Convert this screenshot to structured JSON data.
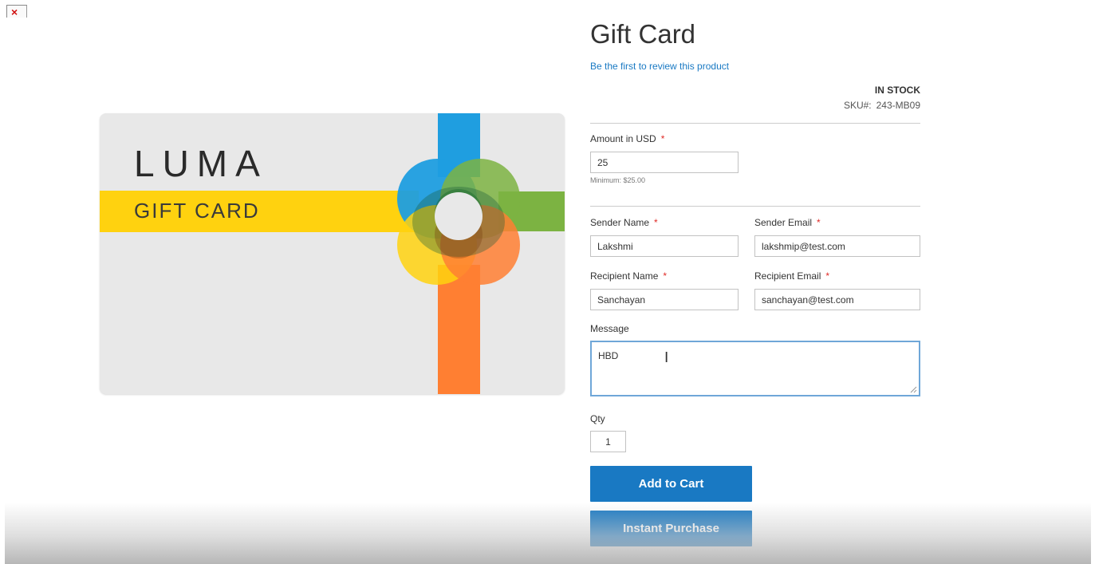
{
  "product": {
    "title": "Gift Card",
    "review_link": "Be the first to review this product",
    "stock": "IN STOCK",
    "sku_label": "SKU#:",
    "sku_value": "243-MB09"
  },
  "card_image": {
    "brand": "LUMA",
    "subtitle": "GIFT CARD",
    "colors": {
      "background": "#e8e8e8",
      "yellow": "#ffd20f",
      "blue": "#1f9ee0",
      "green": "#7cb342",
      "orange": "#ff7f32"
    }
  },
  "form": {
    "amount": {
      "label": "Amount in USD",
      "required": "*",
      "value": "25",
      "hint": "Minimum: $25.00"
    },
    "sender_name": {
      "label": "Sender Name",
      "required": "*",
      "value": "Lakshmi"
    },
    "sender_email": {
      "label": "Sender Email",
      "required": "*",
      "value": "lakshmip@test.com"
    },
    "recipient_name": {
      "label": "Recipient Name",
      "required": "*",
      "value": "Sanchayan"
    },
    "recipient_email": {
      "label": "Recipient Email",
      "required": "*",
      "value": "sanchayan@test.com"
    },
    "message": {
      "label": "Message",
      "value": "HBD"
    },
    "qty": {
      "label": "Qty",
      "value": "1"
    }
  },
  "actions": {
    "add_to_cart": "Add to Cart",
    "instant_purchase": "Instant Purchase"
  },
  "colors": {
    "accent": "#1979c3",
    "required": "#e02b27",
    "focus_border": "#6fa7d8"
  },
  "icons": {
    "broken_image": "broken-image-icon",
    "text_cursor": "text-cursor-icon",
    "resize_grip": "resize-grip-icon"
  }
}
